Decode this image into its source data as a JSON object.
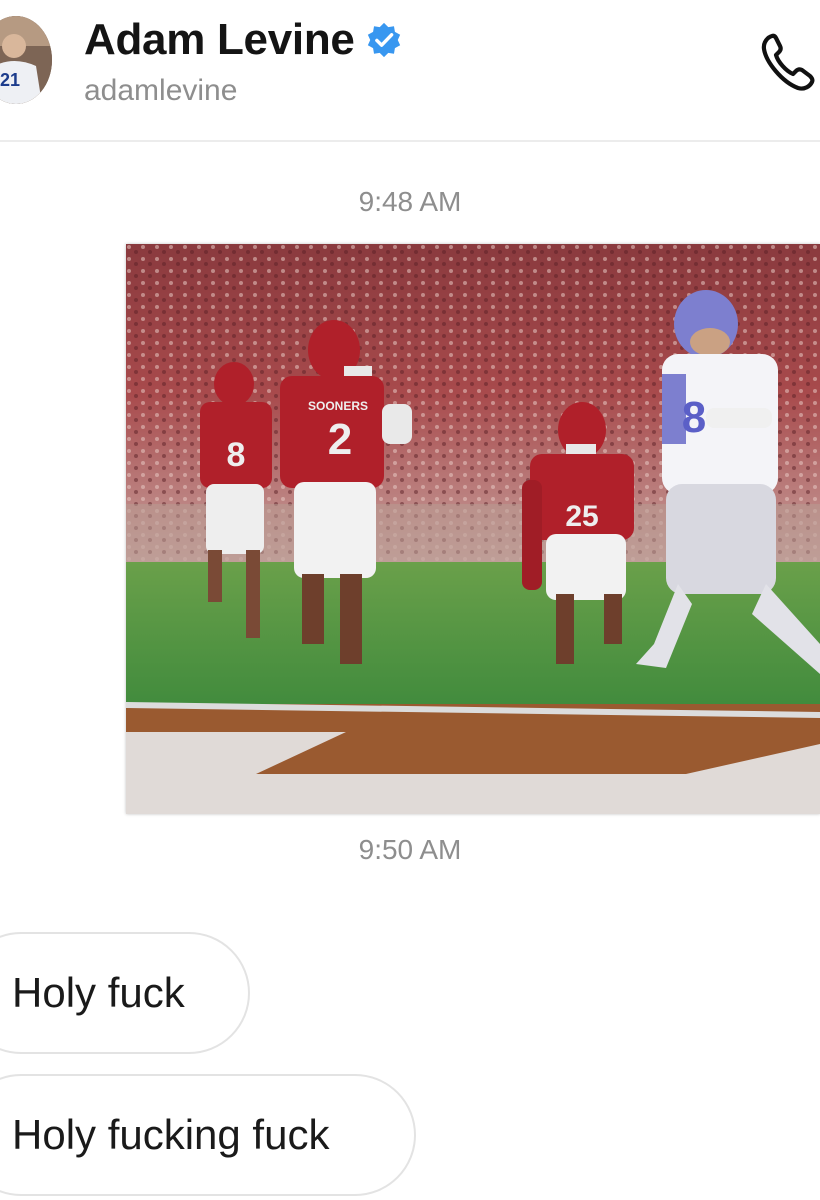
{
  "header": {
    "contact_name": "Adam Levine",
    "username": "adamlevine",
    "verified": true,
    "avatar_jersey_number": "21",
    "icons": {
      "verified": "verified-badge-icon",
      "call": "phone-call-icon"
    },
    "colors": {
      "verified_badge": "#3897f0",
      "name": "#141414",
      "username": "#8e8e8e"
    }
  },
  "messages": [
    {
      "type": "timestamp",
      "text": "9:48 AM"
    },
    {
      "type": "image",
      "alt": "",
      "jersey_numbers": [
        "8",
        "2",
        "25",
        "8"
      ],
      "jersey_text": "SOONERS"
    },
    {
      "type": "timestamp",
      "text": "9:50 AM"
    },
    {
      "type": "text",
      "text": "Holy fuck"
    },
    {
      "type": "text",
      "text": "Holy fucking fuck"
    }
  ]
}
